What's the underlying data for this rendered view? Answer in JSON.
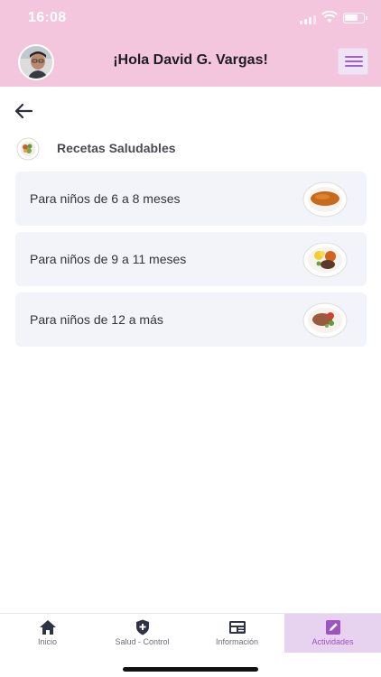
{
  "status_bar": {
    "time": "16:08"
  },
  "header": {
    "greeting": "¡Hola David G. Vargas!"
  },
  "section": {
    "title": "Recetas Saludables"
  },
  "recipes": [
    {
      "label": "Para niños de 6 a 8 meses"
    },
    {
      "label": "Para niños de 9 a 11 meses"
    },
    {
      "label": "Para niños de 12 a más"
    }
  ],
  "bottom_nav": [
    {
      "label": "Inicio",
      "icon": "home-icon",
      "active": false
    },
    {
      "label": "Salud - Control",
      "icon": "shield-cross-icon",
      "active": false
    },
    {
      "label": "Información",
      "icon": "news-icon",
      "active": false
    },
    {
      "label": "Actividades",
      "icon": "edit-note-icon",
      "active": true
    }
  ],
  "colors": {
    "header_bg": "#f4c6dd",
    "accent": "#a460c8",
    "active_tab_bg": "#e7d2ef",
    "card_bg": "#f2f4f9"
  }
}
